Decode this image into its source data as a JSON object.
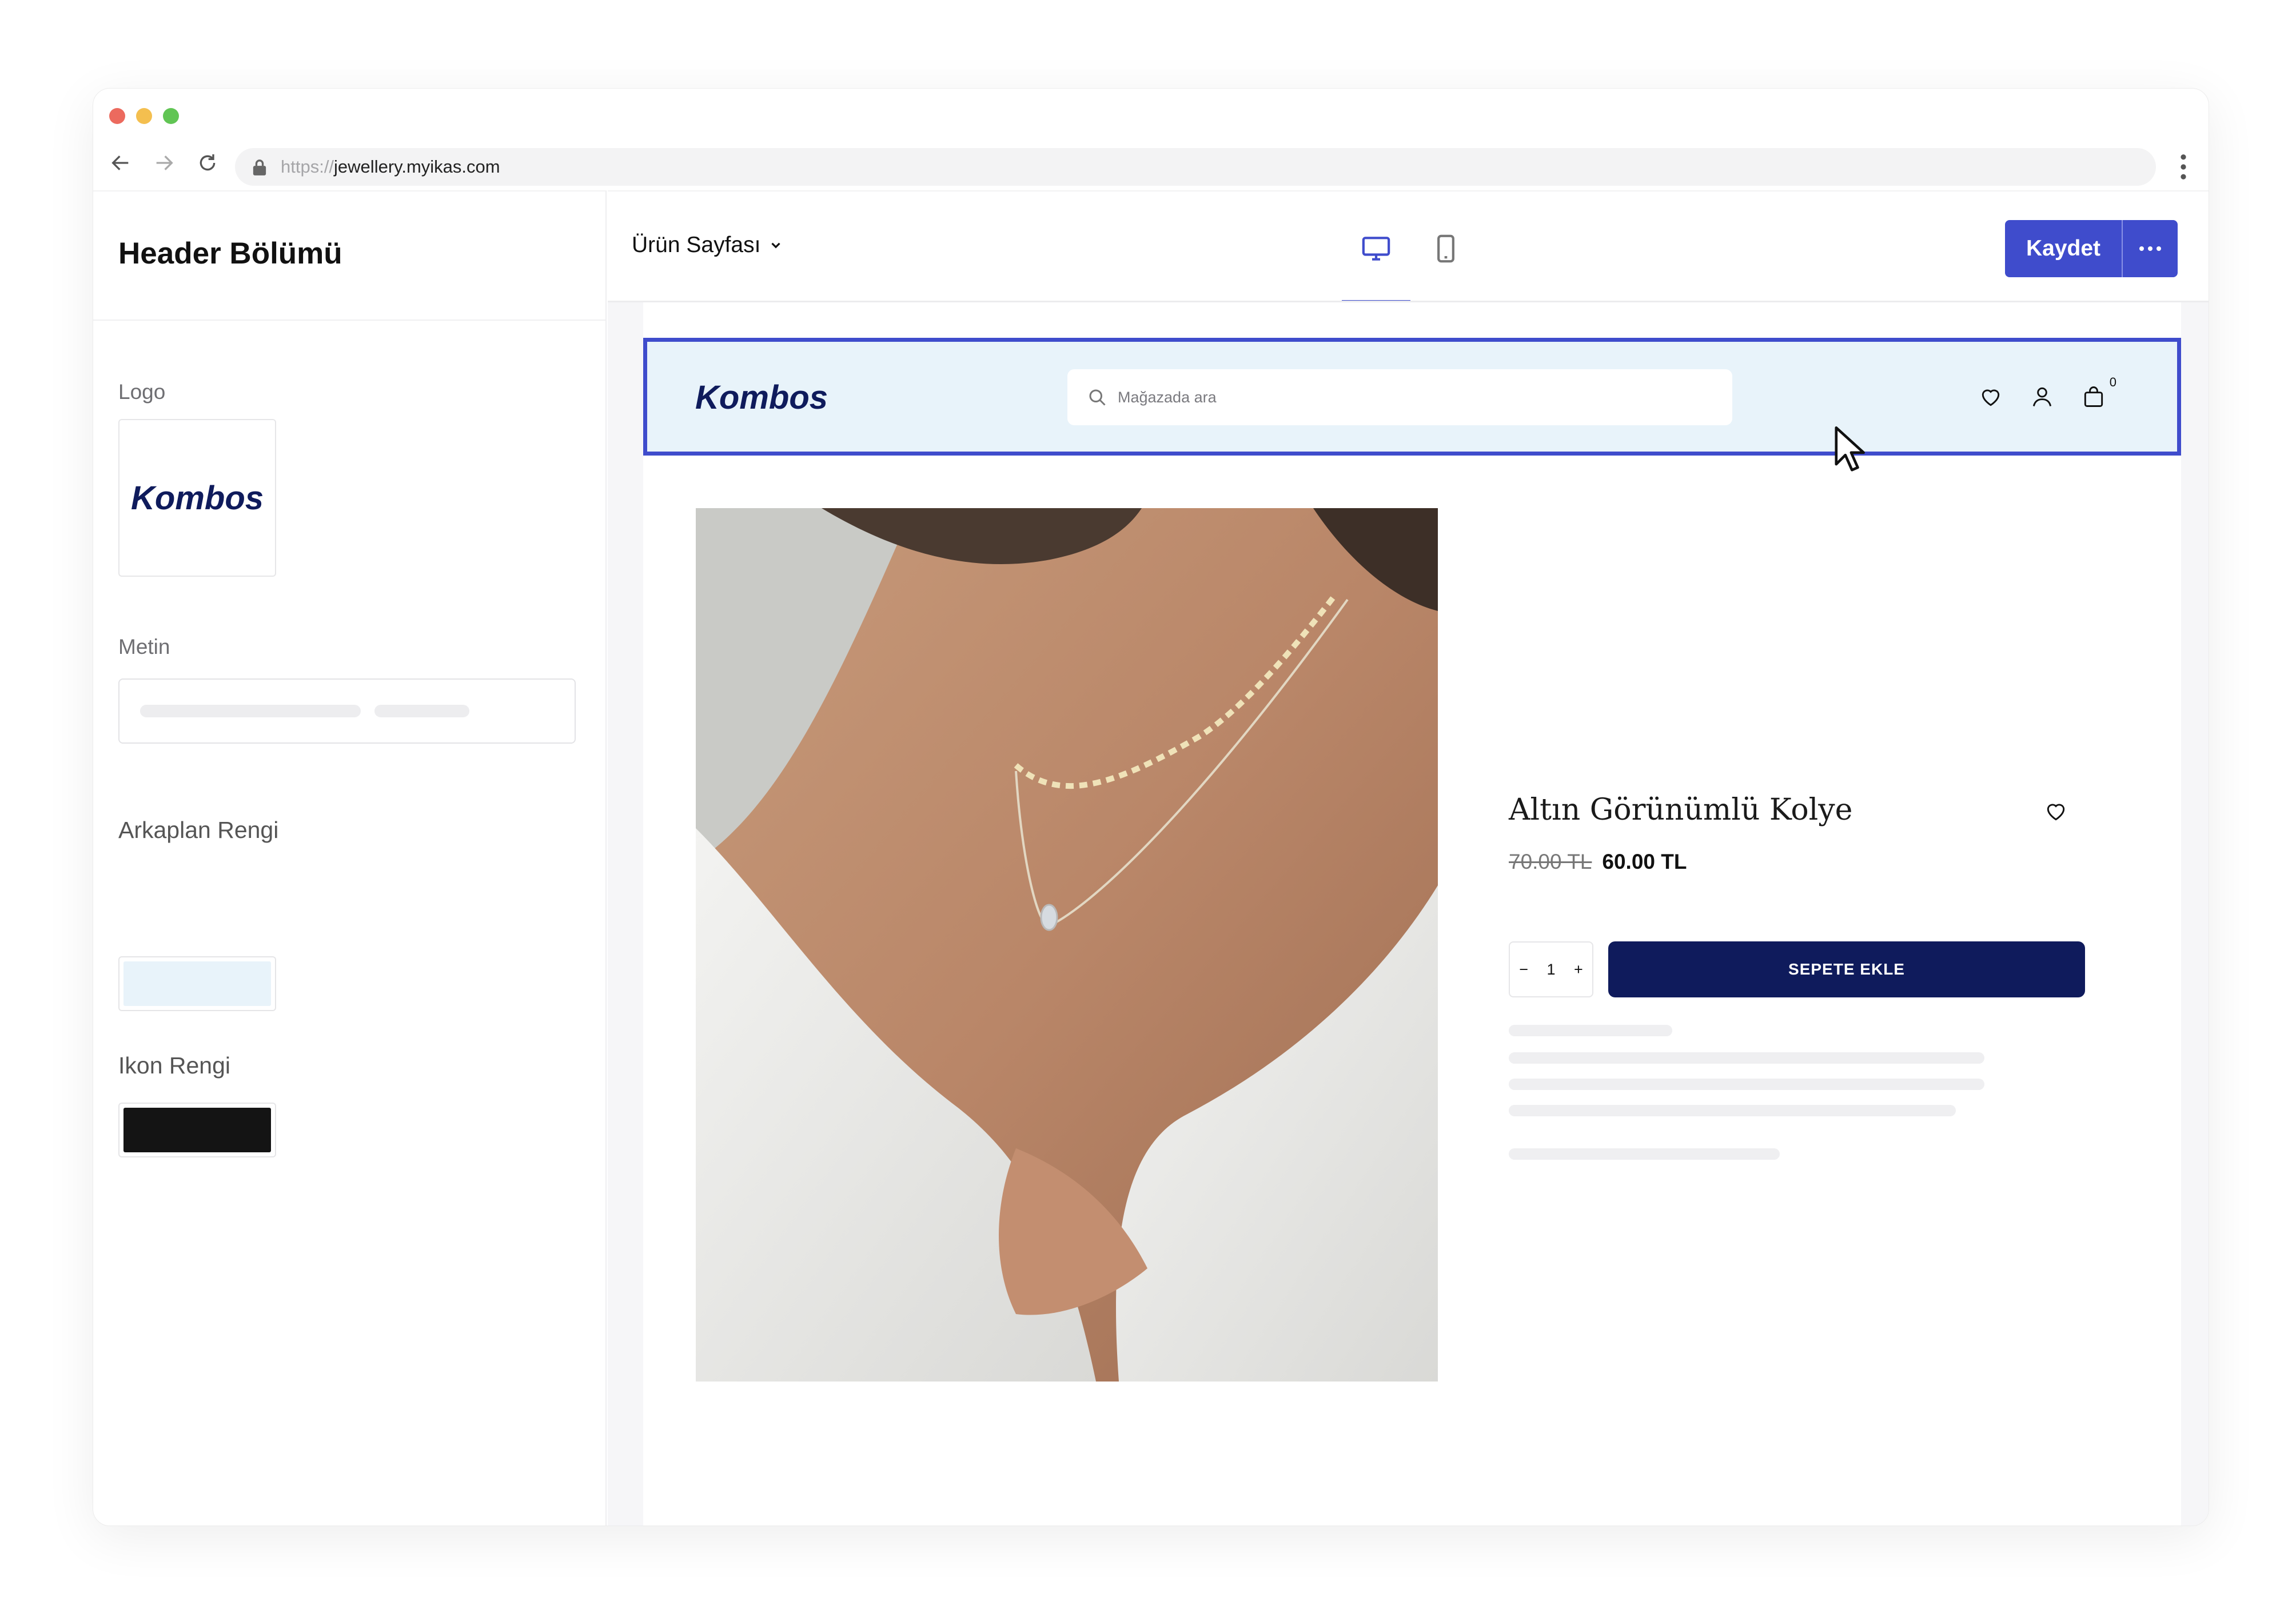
{
  "browser": {
    "url_protocol": "https://",
    "url_host": "jewellery.myikas.com"
  },
  "sidebar": {
    "title": "Header Bölümü",
    "logo_label": "Logo",
    "logo_text": "Kombos",
    "text_label": "Metin",
    "bg_color_label": "Arkaplan Rengi",
    "bg_color_value": "#e8f3fa",
    "icon_color_label": "Ikon Rengi",
    "icon_color_value": "#111111"
  },
  "toolbar": {
    "page_select": "Ürün Sayfası",
    "save_label": "Kaydet",
    "active_device": "desktop"
  },
  "site_header": {
    "logo": "Kombos",
    "search_placeholder": "Mağazada ara",
    "cart_count": "0"
  },
  "product": {
    "title": "Altın Görünümlü Kolye",
    "old_price": "70.00 TL",
    "new_price": "60.00 TL",
    "quantity": "1",
    "qty_minus": "−",
    "qty_plus": "+",
    "add_to_cart": "SEPETE EKLE"
  },
  "colors": {
    "accent": "#3f4ccc",
    "brand_navy": "#0f1b5c"
  }
}
